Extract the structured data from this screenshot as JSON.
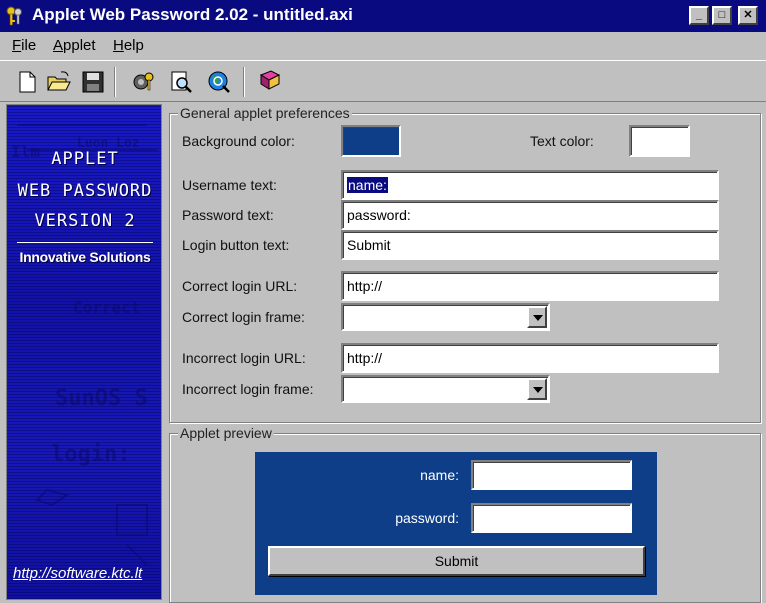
{
  "window": {
    "title": "Applet Web Password 2.02 - untitled.axi",
    "minimize_label": "_",
    "maximize_label": "□",
    "close_label": "✕"
  },
  "menu": {
    "file": {
      "accel": "F",
      "rest": "ile"
    },
    "applet": {
      "accel": "A",
      "rest": "pplet"
    },
    "help": {
      "accel": "H",
      "rest": "elp"
    }
  },
  "toolbar": {
    "icons": [
      "new-file-icon",
      "open-folder-icon",
      "save-disk-icon",
      "settings-icon",
      "preview-icon",
      "browser-icon",
      "help-book-icon"
    ]
  },
  "banner": {
    "line1": "APPLET",
    "line2": "WEB PASSWORD",
    "line3": "VERSION 2",
    "company": "Innovative Solutions",
    "url": "http://software.ktc.lt"
  },
  "prefs": {
    "group_title": "General applet preferences",
    "background_color_label": "Background color:",
    "background_color": "#0e3e88",
    "text_color_label": "Text color:",
    "text_color": "#ffffff",
    "username_label": "Username text:",
    "username_value": "name:",
    "password_label": "Password text:",
    "password_value": "password:",
    "login_button_label": "Login button text:",
    "login_button_value": "Submit",
    "correct_url_label": "Correct login URL:",
    "correct_url_value": "http://",
    "correct_frame_label": "Correct login frame:",
    "correct_frame_value": "",
    "incorrect_url_label": "Incorrect login URL:",
    "incorrect_url_value": "http://",
    "incorrect_frame_label": "Incorrect login frame:",
    "incorrect_frame_value": ""
  },
  "preview": {
    "group_title": "Applet preview",
    "name_label": "name:",
    "password_label": "password:",
    "submit_label": "Submit"
  },
  "colors": {
    "title_bar": "#0a0a80",
    "face": "#c0c0c0",
    "banner_blue": "#1515b8",
    "preview_blue": "#0e3e88"
  }
}
